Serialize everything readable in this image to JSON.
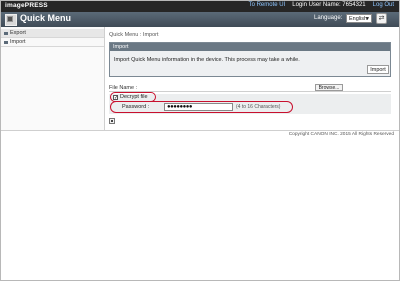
{
  "header": {
    "brand": "imagePRESS",
    "remote_ui_link": "To Remote UI",
    "login_user": "Login User Name: 7654321",
    "logout": "Log Out"
  },
  "titlebar": {
    "title": "Quick Menu",
    "language_label": "Language:",
    "language_value": "English"
  },
  "sidebar": {
    "items": [
      {
        "label": "Export"
      },
      {
        "label": "Import"
      }
    ]
  },
  "main": {
    "breadcrumb": "Quick Menu : Import",
    "panel_title": "Import",
    "description": "Import Quick Menu information in the device. This process may take a while.",
    "import_button": "Import",
    "file_name_label": "File Name :",
    "browse_button": "Browse...",
    "decrypt_label": "Decrypt file",
    "decrypt_checked": true,
    "password_label": "Password :",
    "password_value": "●●●●●●●●",
    "password_hint": "(4 to 16 Characters)"
  },
  "footer": {
    "copyright": "Copyright CANON INC. 2015 All Rights Reserved"
  },
  "colors": {
    "topbar": "#262626",
    "titlebar": "#4a5763",
    "panel_header": "#6a7884",
    "highlight": "#c8102e",
    "link": "#8ec5ff"
  }
}
